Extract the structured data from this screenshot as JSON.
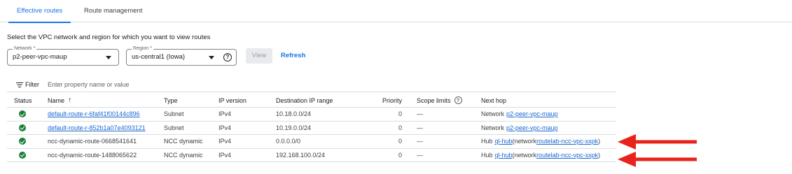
{
  "tabs": [
    {
      "label": "Effective routes",
      "active": true
    },
    {
      "label": "Route management",
      "active": false
    }
  ],
  "instruction": "Select the VPC network and region for which you want to view routes",
  "network": {
    "label": "Network *",
    "value": "p2-peer-vpc-maup"
  },
  "region": {
    "label": "Region *",
    "value": "us-central1 (Iowa)",
    "help": "?"
  },
  "buttons": {
    "view": "View",
    "refresh": "Refresh"
  },
  "filter": {
    "label": "Filter",
    "placeholder": "Enter property name or value"
  },
  "table": {
    "headers": {
      "status": "Status",
      "name": "Name",
      "name_sort": "↑",
      "type": "Type",
      "ip_version": "IP version",
      "destination": "Destination IP range",
      "priority": "Priority",
      "scope": "Scope limits",
      "scope_help": "?",
      "next_hop": "Next hop"
    },
    "rows": [
      {
        "name": "default-route-r-6faf41f00144c896",
        "name_link": true,
        "type": "Subnet",
        "ip_version": "IPv4",
        "destination": "10.18.0.0/24",
        "priority": "0",
        "scope": "—",
        "next_prefix": "Network ",
        "next_link": "p2-peer-vpc-maup",
        "next_mid": "",
        "next_link2": "",
        "next_suffix": ""
      },
      {
        "name": "default-route-r-852b1a07e4093121",
        "name_link": true,
        "type": "Subnet",
        "ip_version": "IPv4",
        "destination": "10.19.0.0/24",
        "priority": "0",
        "scope": "—",
        "next_prefix": "Network ",
        "next_link": "p2-peer-vpc-maup",
        "next_mid": "",
        "next_link2": "",
        "next_suffix": ""
      },
      {
        "name": "ncc-dynamic-route-0668541641",
        "name_link": false,
        "type": "NCC dynamic",
        "ip_version": "IPv4",
        "destination": "0.0.0.0/0",
        "priority": "0",
        "scope": "—",
        "next_prefix": "Hub ",
        "next_link": "ql-hub",
        "next_mid": " (network ",
        "next_link2": "routelab-ncc-vpc-xxpk",
        "next_suffix": ")"
      },
      {
        "name": "ncc-dynamic-route-1488065622",
        "name_link": false,
        "type": "NCC dynamic",
        "ip_version": "IPv4",
        "destination": "192.168.100.0/24",
        "priority": "0",
        "scope": "—",
        "next_prefix": "Hub ",
        "next_link": "ql-hub",
        "next_mid": " (network ",
        "next_link2": "routelab-ncc-vpc-xxpk",
        "next_suffix": ")"
      }
    ]
  },
  "colors": {
    "accent": "#1a73e8",
    "status_ok": "#188038",
    "annotation": "#e8231c"
  }
}
